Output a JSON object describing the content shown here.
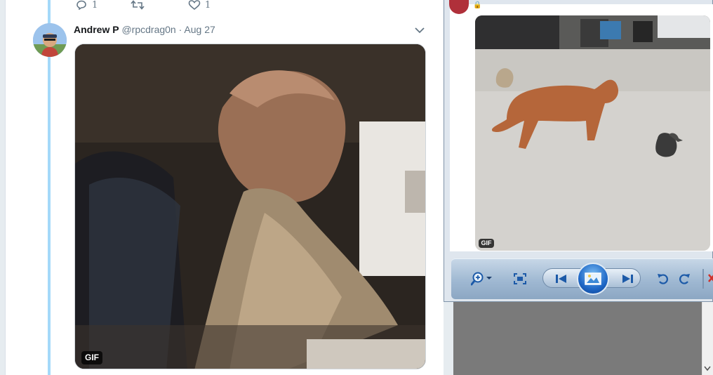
{
  "previous_tweet": {
    "reply_count": "1",
    "retweet_count": "",
    "like_count": "1"
  },
  "tweet": {
    "author_name": "Andrew P",
    "author_handle": "@rpcdrag0n",
    "separator": "·",
    "date": "Aug 27",
    "media_badge": "GIF",
    "media_description": "animated gif"
  },
  "viewer": {
    "media_badge": "GIF",
    "emoji": "🔒",
    "toolbar": {
      "zoom": "zoom-icon",
      "fit": "actual-size-icon",
      "previous": "previous-icon",
      "slideshow": "slideshow-icon",
      "next": "next-icon",
      "rotate_ccw": "rotate-counterclockwise-icon",
      "rotate_cw": "rotate-clockwise-icon",
      "delete": "delete-icon"
    }
  },
  "colors": {
    "thread_line": "#a4d9f9",
    "muted_text": "#657786",
    "name_text": "#14171a",
    "toolbar_blue": "#1e67c6"
  }
}
